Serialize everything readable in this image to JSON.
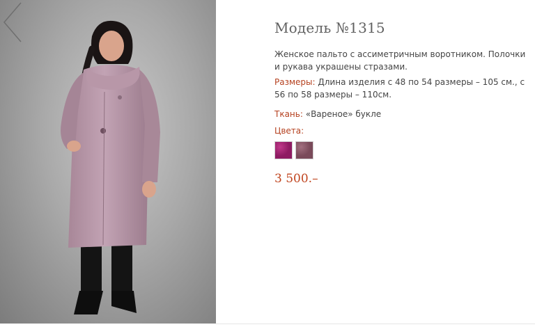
{
  "product": {
    "title": "Модель №1315",
    "description": "Женское пальто с ассиметричным воротником. Полочки и рукава украшены  стразами.",
    "sizes_label": "Размеры:",
    "sizes_value": "Длина изделия с 48 по 54 размеры – 105 см., с 56 по 58 размеры – 110см.",
    "fabric_label": "Ткань:",
    "fabric_value": "«Вареное» букле",
    "colors_label": "Цвета:",
    "swatches": [
      {
        "name": "magenta-boucle",
        "color": "#8e1a62",
        "accent": "#c0398a"
      },
      {
        "name": "mauve-boucle",
        "color": "#7a4a5a",
        "accent": "#a27080"
      }
    ],
    "price": "3 500.–"
  },
  "gallery": {
    "prev_icon": "chevron-left-icon",
    "photo_subject": "woman-in-pink-coat"
  }
}
